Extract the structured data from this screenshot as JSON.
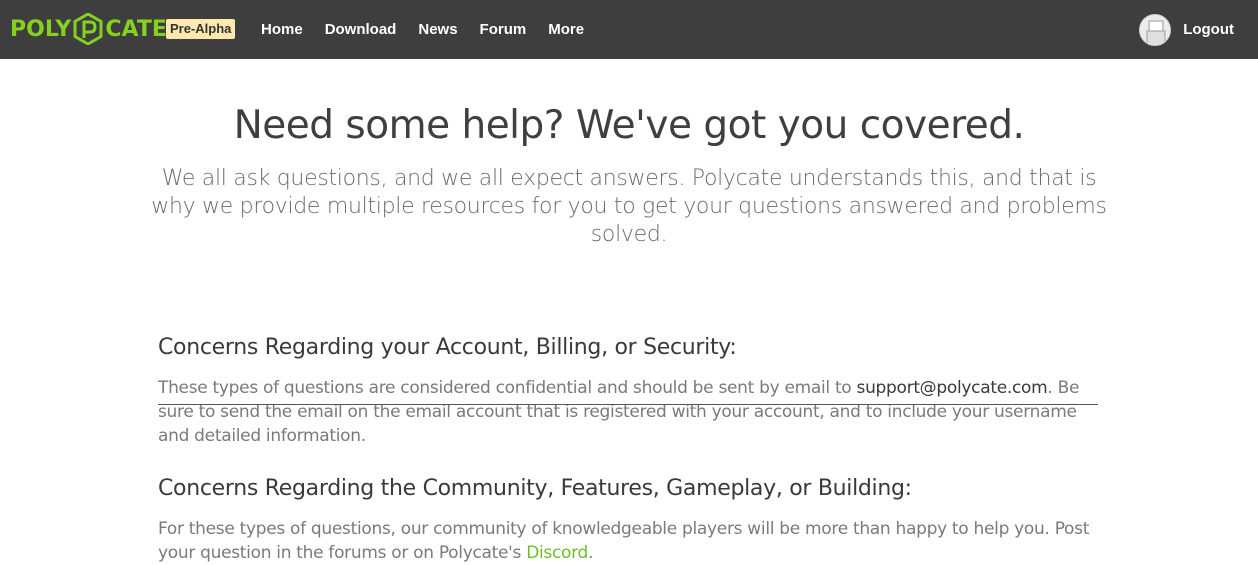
{
  "brand": {
    "name_left": "POLY",
    "name_right": "CATE",
    "badge": "Pre-Alpha",
    "accent_color": "#86d11f"
  },
  "nav": {
    "items": [
      {
        "label": "Home"
      },
      {
        "label": "Download"
      },
      {
        "label": "News"
      },
      {
        "label": "Forum"
      },
      {
        "label": "More"
      }
    ],
    "logout_label": "Logout"
  },
  "hero": {
    "title": "Need some help? We've got you covered.",
    "subtitle": "We all ask questions, and we all expect answers. Polycate understands this, and that is why we provide multiple resources for you to get your questions answered and problems solved."
  },
  "sections": [
    {
      "heading": "Concerns Regarding your Account, Billing, or Security:",
      "text_before": "These types of questions are considered confidential and should be sent by email to ",
      "email": "support@polycate.com",
      "text_after": ". Be sure to send the email on the email account that is registered with your account, and to include your username and detailed information."
    },
    {
      "heading": "Concerns Regarding the Community, Features, Gameplay, or Building:",
      "text_before": "For these types of questions, our community of knowledgeable players will be more than happy to help you. Post your question in the forums or on Polycate's ",
      "link": "Discord",
      "text_after": "."
    }
  ]
}
